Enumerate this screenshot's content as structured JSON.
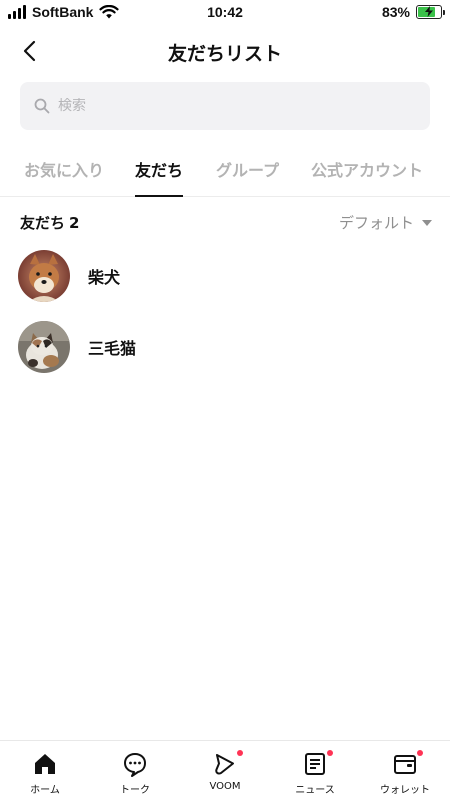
{
  "status_bar": {
    "carrier": "SoftBank",
    "time": "10:42",
    "battery_percent": "83%",
    "battery_level": 0.83,
    "battery_color": "#3bc14a"
  },
  "header": {
    "title": "友だちリスト",
    "back_icon": "chevron-left-icon"
  },
  "search": {
    "placeholder": "検索",
    "icon": "search-icon"
  },
  "tabs": [
    {
      "label": "お気に入り",
      "active": false
    },
    {
      "label": "友だち",
      "active": true
    },
    {
      "label": "グループ",
      "active": false
    },
    {
      "label": "公式アカウント",
      "active": false
    }
  ],
  "section": {
    "title": "友だち",
    "count": "2",
    "sort_label": "デフォルト"
  },
  "friends": [
    {
      "name": "柴犬",
      "avatar": "shiba-dog-photo"
    },
    {
      "name": "三毛猫",
      "avatar": "calico-cat-photo"
    }
  ],
  "bottom_nav": [
    {
      "label": "ホーム",
      "icon": "home-icon",
      "badge": false
    },
    {
      "label": "トーク",
      "icon": "chat-bubble-icon",
      "badge": false
    },
    {
      "label": "VOOM",
      "icon": "voom-play-icon",
      "badge": true
    },
    {
      "label": "ニュース",
      "icon": "news-icon",
      "badge": true
    },
    {
      "label": "ウォレット",
      "icon": "wallet-icon",
      "badge": true
    }
  ],
  "colors": {
    "badge": "#ff3355",
    "inactive_tab": "#b3b3b3",
    "search_bg": "#f2f2f4"
  }
}
